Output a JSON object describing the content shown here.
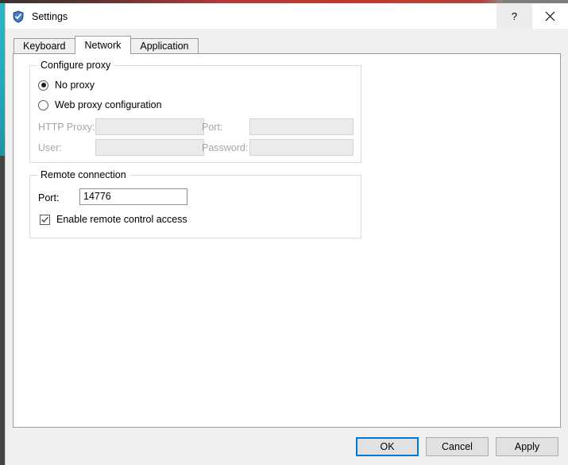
{
  "window": {
    "title": "Settings",
    "icon": "shield-check-icon",
    "help_label": "?",
    "close_label": "close-icon",
    "accent_color": "#0078d7"
  },
  "tabs": [
    {
      "label": "Keyboard",
      "active": false
    },
    {
      "label": "Network",
      "active": true
    },
    {
      "label": "Application",
      "active": false
    }
  ],
  "configure_proxy": {
    "title": "Configure proxy",
    "radios": [
      {
        "label": "No proxy",
        "selected": true
      },
      {
        "label": "Web proxy configuration",
        "selected": false
      }
    ],
    "fields": {
      "http_proxy_label": "HTTP Proxy:",
      "http_proxy_value": "",
      "http_proxy_placeholder": "",
      "port_label": "Port:",
      "port_value": "",
      "port_placeholder": "",
      "user_label": "User:",
      "user_value": "",
      "user_placeholder": "",
      "password_label": "Password:",
      "password_value": "",
      "password_placeholder": ""
    }
  },
  "remote_connection": {
    "title": "Remote connection",
    "port_label": "Port:",
    "port_value": "14776",
    "port_placeholder": "",
    "checkbox_label": "Enable remote control access",
    "checkbox_checked": true
  },
  "footer": {
    "ok_label": "OK",
    "cancel_label": "Cancel",
    "apply_label": "Apply"
  }
}
